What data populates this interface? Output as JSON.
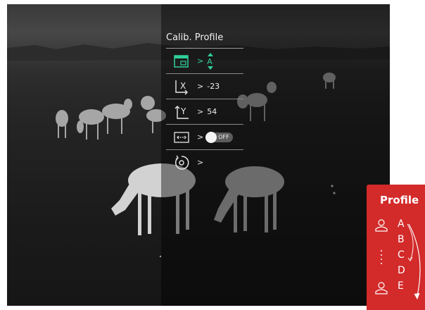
{
  "menu": {
    "title": "Calib. Profile",
    "rows": [
      {
        "icon": "profile-card-icon",
        "arrow": ">",
        "value": "A"
      },
      {
        "icon": "x-axis-icon",
        "arrow": ">",
        "value": "-23"
      },
      {
        "icon": "y-axis-icon",
        "arrow": ">",
        "value": "54"
      },
      {
        "icon": "horizontal-flip-icon",
        "arrow": ">",
        "toggle_label": "OFF"
      },
      {
        "icon": "reset-icon",
        "arrow": ">"
      }
    ]
  },
  "profile_panel": {
    "title": "Profile",
    "items": [
      "A",
      "B",
      "C",
      "D",
      "E"
    ]
  },
  "colors": {
    "accent": "#2fcf9a",
    "panel": "#d32a2a"
  }
}
